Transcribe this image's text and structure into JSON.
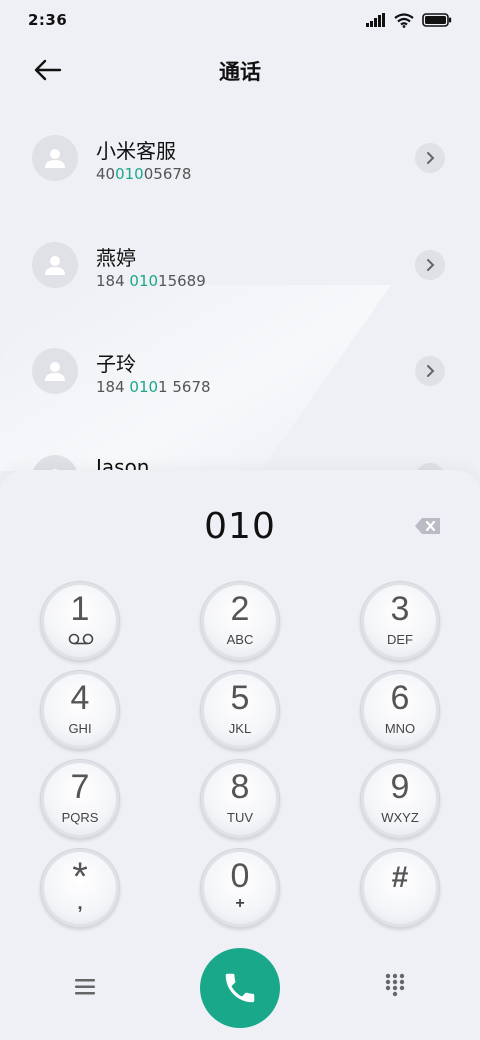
{
  "status_bar": {
    "time": "2:36"
  },
  "header": {
    "title": "通话"
  },
  "contacts": [
    {
      "name": "小米客服",
      "number_pre": "40",
      "number_hl": "010",
      "number_post": "05678"
    },
    {
      "name": "燕婷",
      "number_pre": "184 ",
      "number_hl": "010",
      "number_post": "15689"
    },
    {
      "name": "子玲",
      "number_pre": "184 ",
      "number_hl": "010",
      "number_post": "1 5678"
    },
    {
      "name": "Jason",
      "number_pre": "",
      "number_hl": "",
      "number_post": ""
    }
  ],
  "dialpad": {
    "input": "010",
    "keys": [
      {
        "digit": "1",
        "letters": "",
        "icon": "voicemail-icon"
      },
      {
        "digit": "2",
        "letters": "ABC"
      },
      {
        "digit": "3",
        "letters": "DEF"
      },
      {
        "digit": "4",
        "letters": "GHI"
      },
      {
        "digit": "5",
        "letters": "JKL"
      },
      {
        "digit": "6",
        "letters": "MNO"
      },
      {
        "digit": "7",
        "letters": "PQRS"
      },
      {
        "digit": "8",
        "letters": "TUV"
      },
      {
        "digit": "9",
        "letters": "WXYZ"
      },
      {
        "digit": "*",
        "letters": ","
      },
      {
        "digit": "0",
        "letters": "+"
      },
      {
        "digit": "#",
        "letters": ""
      }
    ]
  },
  "colors": {
    "accent": "#1aa88a",
    "background": "#eef0f5"
  }
}
